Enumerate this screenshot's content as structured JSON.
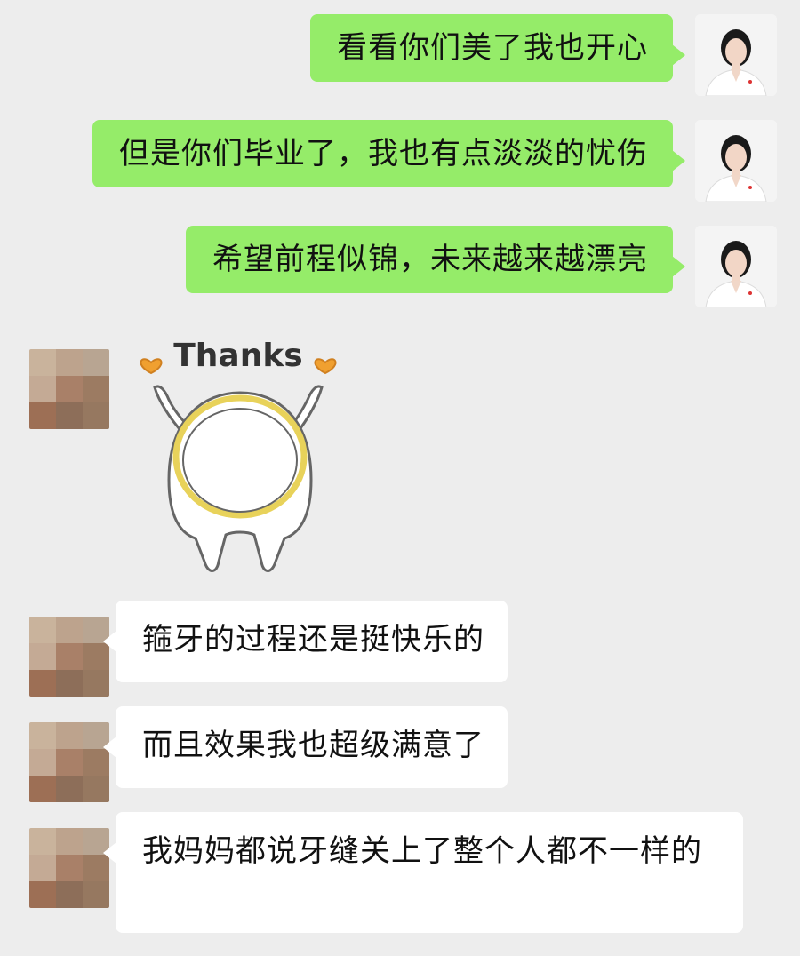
{
  "messages": [
    {
      "side": "self",
      "text": "看看你们美了我也开心"
    },
    {
      "side": "self",
      "text": "但是你们毕业了，我也有点淡淡的忧伤"
    },
    {
      "side": "self",
      "text": "希望前程似锦，未来越来越漂亮"
    },
    {
      "side": "other",
      "type": "sticker",
      "sticker_text": "Thanks",
      "sticker_icon": "thanks-tooth-sticker"
    },
    {
      "side": "other",
      "text": "箍牙的过程还是挺快乐的"
    },
    {
      "side": "other",
      "text": "而且效果我也超级满意了"
    },
    {
      "side": "other",
      "text": "我妈妈都说牙缝关上了整个人都不一样的"
    }
  ],
  "colors": {
    "background": "#ededed",
    "self_bubble": "#95ec69",
    "other_bubble": "#ffffff",
    "sticker_heart": "#f0a030",
    "sticker_ring": "#e8d25a"
  },
  "avatars": {
    "self": "doctor-avatar",
    "other": "pixelated-avatar"
  }
}
